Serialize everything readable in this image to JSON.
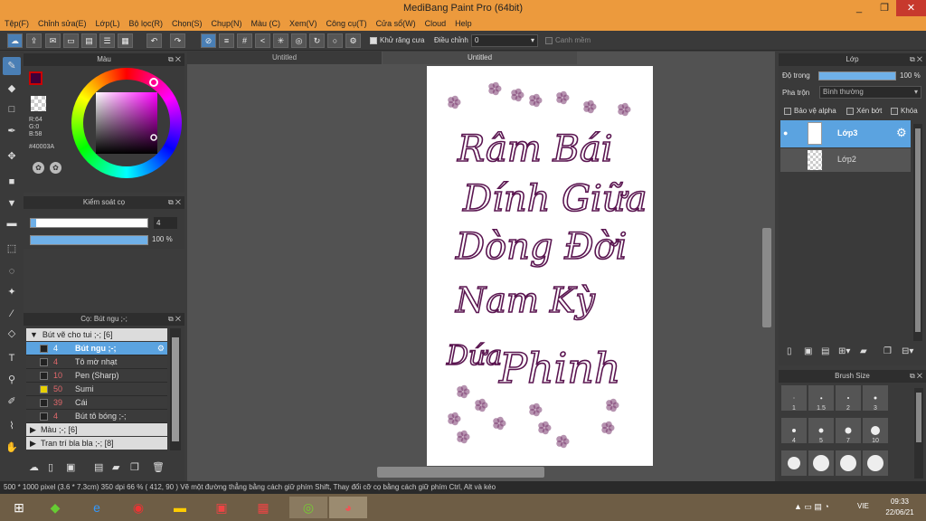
{
  "window": {
    "title": "MediBang Paint Pro (64bit)",
    "min": "_",
    "max": "❐",
    "close": "✕"
  },
  "menu": [
    "Tệp(F)",
    "Chỉnh sửa(E)",
    "Lớp(L)",
    "Bộ lọc(R)",
    "Chọn(S)",
    "Chụp(N)",
    "Màu (C)",
    "Xem(V)",
    "Công cụ(T)",
    "Cửa sổ(W)",
    "Cloud",
    "Help"
  ],
  "toolbar": {
    "antialias_label": "Khử răng cưa",
    "adjust_label": "Điều chỉnh",
    "adjust_value": "0",
    "snap_label": "Canh mềm"
  },
  "color_panel": {
    "title": "Màu",
    "r": "R:64",
    "g": "G:0",
    "b": "B:58",
    "hex": "#40003A",
    "primary": "#40003a",
    "secondary": "#000000"
  },
  "brush_control": {
    "title": "Kiểm soát cọ",
    "size": "4",
    "opacity": "100 %",
    "size_fraction": 0.05,
    "opacity_fraction": 1.0
  },
  "brush_panel": {
    "title": "Cọ: Bút ngu ;-;",
    "group1": "Bút vẽ cho tui ;-; [6]",
    "brushes": [
      {
        "size": "4",
        "name": "Bút ngu ;-;",
        "color": "#222222",
        "active": true
      },
      {
        "size": "4",
        "name": "Tô mờ nhạt",
        "color": "#222222",
        "active": false
      },
      {
        "size": "10",
        "name": "Pen (Sharp)",
        "color": "#222222",
        "active": false
      },
      {
        "size": "50",
        "name": "Sumi",
        "color": "#e8d000",
        "active": false
      },
      {
        "size": "39",
        "name": "Cái",
        "color": "#222222",
        "active": false
      },
      {
        "size": "4",
        "name": "Bút tô bóng ;-;",
        "color": "#222222",
        "active": false
      }
    ],
    "group2": "Màu ;-; [6]",
    "group3": "Tran trí bla bla ;-; [8]"
  },
  "tabs": [
    "Untitled",
    "Untitled"
  ],
  "canvas": {
    "line1": "Râm Bái",
    "line2": "Dính Giữa",
    "line3": "Dòng Đời",
    "line4": "Nam Kỳ",
    "line5": "Dứa",
    "line6": "Phinh",
    "ink": "#5a1550"
  },
  "layers": {
    "title": "Lớp",
    "opacity_label": "Độ trong",
    "opacity_value": "100 %",
    "opacity_fraction": 1.0,
    "blend_label": "Pha trộn",
    "blend_value": "Bình thường",
    "alpha_label": "Bảo vệ alpha",
    "clip_label": "Xén bớt",
    "lock_label": "Khóa",
    "items": [
      {
        "name": "Lớp3",
        "active": true
      },
      {
        "name": "Lớp2",
        "active": false
      }
    ]
  },
  "brush_size": {
    "title": "Brush Size",
    "sizes": [
      "1",
      "1.5",
      "2",
      "3",
      "4",
      "5",
      "7",
      "10"
    ]
  },
  "status": "500 * 1000 pixel   (3.6 * 7.3cm)   350 dpi   66 %   ( 412, 90 )   Vẽ một đường thẳng bằng cách giữ phím Shift, Thay đổi cỡ cọ bằng cách giữ phím Ctrl, Alt và kéo",
  "taskbar": {
    "lang": "VIE",
    "time": "09:33",
    "date": "22/06/21"
  }
}
